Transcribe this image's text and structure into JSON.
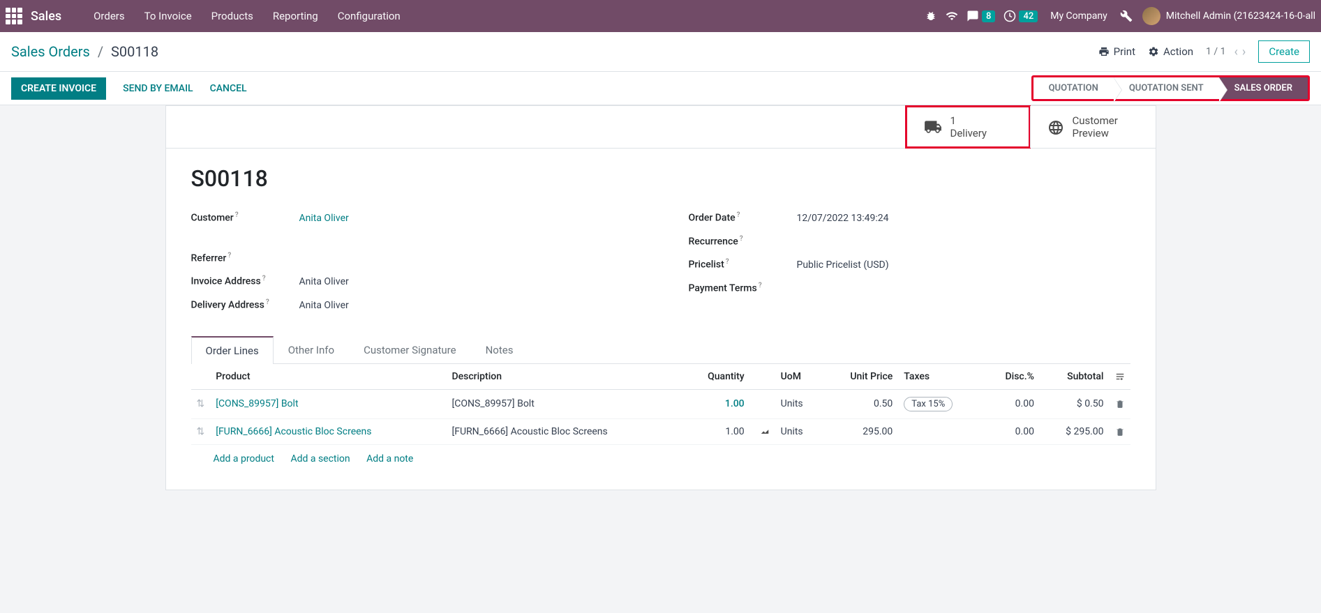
{
  "navbar": {
    "brand": "Sales",
    "menu": [
      "Orders",
      "To Invoice",
      "Products",
      "Reporting",
      "Configuration"
    ],
    "messages_badge": "8",
    "activities_badge": "42",
    "company": "My Company",
    "user": "Mitchell Admin (21623424-16-0-all"
  },
  "breadcrumb": {
    "root": "Sales Orders",
    "leaf": "S00118"
  },
  "cp": {
    "print": "Print",
    "action": "Action",
    "pager": "1 / 1",
    "create": "Create"
  },
  "actions": {
    "create_invoice": "CREATE INVOICE",
    "send_email": "SEND BY EMAIL",
    "cancel": "CANCEL"
  },
  "status": {
    "quotation": "QUOTATION",
    "quotation_sent": "QUOTATION SENT",
    "sales_order": "SALES ORDER"
  },
  "stat": {
    "delivery_count": "1",
    "delivery_label": "Delivery",
    "preview_l1": "Customer",
    "preview_l2": "Preview"
  },
  "order": {
    "name": "S00118",
    "customer_label": "Customer",
    "customer": "Anita Oliver",
    "referrer_label": "Referrer",
    "invoice_addr_label": "Invoice Address",
    "invoice_addr": "Anita Oliver",
    "delivery_addr_label": "Delivery Address",
    "delivery_addr": "Anita Oliver",
    "order_date_label": "Order Date",
    "order_date": "12/07/2022 13:49:24",
    "recurrence_label": "Recurrence",
    "pricelist_label": "Pricelist",
    "pricelist": "Public Pricelist (USD)",
    "payment_terms_label": "Payment Terms"
  },
  "tabs": {
    "order_lines": "Order Lines",
    "other_info": "Other Info",
    "signature": "Customer Signature",
    "notes": "Notes"
  },
  "table": {
    "headers": {
      "product": "Product",
      "description": "Description",
      "quantity": "Quantity",
      "uom": "UoM",
      "unit_price": "Unit Price",
      "taxes": "Taxes",
      "disc": "Disc.%",
      "subtotal": "Subtotal"
    },
    "rows": [
      {
        "product": "[CONS_89957] Bolt",
        "desc": "[CONS_89957] Bolt",
        "qty": "1.00",
        "uom": "Units",
        "price": "0.50",
        "taxes": "Tax 15%",
        "disc": "0.00",
        "subtotal": "$ 0.50",
        "qty_link": true
      },
      {
        "product": "[FURN_6666] Acoustic Bloc Screens",
        "desc": "[FURN_6666] Acoustic Bloc Screens",
        "qty": "1.00",
        "uom": "Units",
        "price": "295.00",
        "taxes": "",
        "disc": "0.00",
        "subtotal": "$ 295.00",
        "has_chart": true
      }
    ],
    "add_product": "Add a product",
    "add_section": "Add a section",
    "add_note": "Add a note"
  }
}
